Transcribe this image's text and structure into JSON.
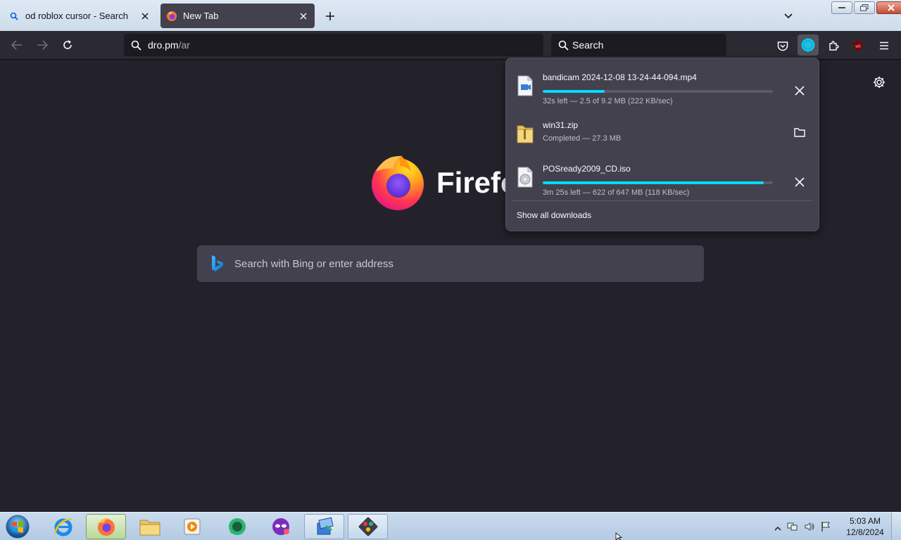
{
  "tabs": [
    {
      "label": "od roblox cursor - Search",
      "icon": "search-icon",
      "active": false
    },
    {
      "label": "New Tab",
      "icon": "firefox-icon",
      "active": true
    }
  ],
  "toolbar": {
    "url_host": "dro.pm",
    "url_path": "/ar",
    "search_placeholder": "Search"
  },
  "newtab": {
    "wordmark": "Firefox",
    "search_placeholder": "Search with Bing or enter address"
  },
  "downloads": {
    "items": [
      {
        "name": "bandicam 2024-12-08 13-24-44-094.mp4",
        "status": "32s left — 2.5 of 9.2 MB (222 KB/sec)",
        "progress": 0.27,
        "in_progress": true,
        "file_icon": "video-file-icon"
      },
      {
        "name": "win31.zip",
        "status": "Completed — 27.3 MB",
        "progress": 1.0,
        "in_progress": false,
        "file_icon": "zip-folder-icon"
      },
      {
        "name": "POSready2009_CD.iso",
        "status": "3m 25s left — 622 of 647 MB (118 KB/sec)",
        "progress": 0.96,
        "in_progress": true,
        "file_icon": "disc-image-icon"
      }
    ],
    "show_all": "Show all downloads"
  },
  "taskbar": {
    "time": "5:03 AM",
    "date": "12/8/2024",
    "apps": [
      "internet-explorer-icon",
      "firefox-icon",
      "file-explorer-icon",
      "media-player-icon",
      "chat-app-icon",
      "mask-app-icon",
      "installer-icon",
      "tools-app-icon"
    ]
  },
  "colors": {
    "accent": "#00ddff",
    "panel_bg": "#42414d",
    "page_bg": "#23222b",
    "toolbar_bg": "#2b2a33"
  }
}
